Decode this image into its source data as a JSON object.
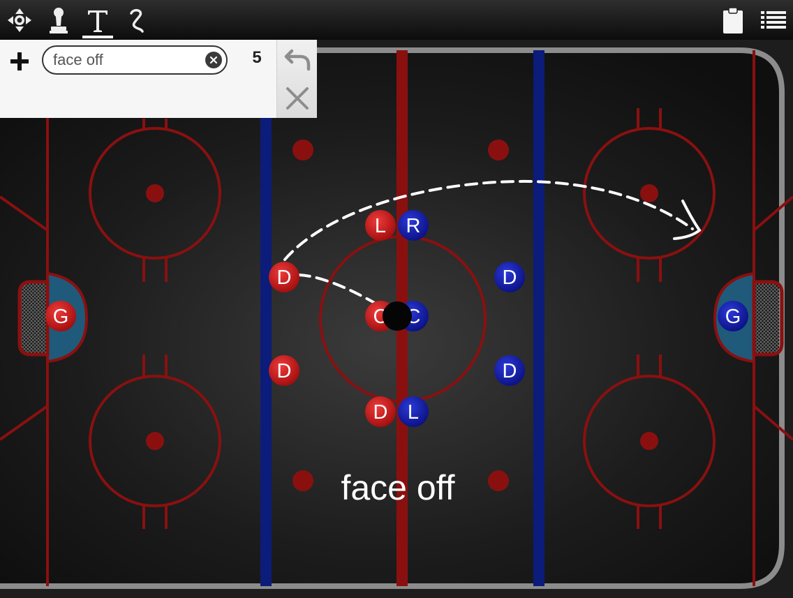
{
  "toolbar": {
    "tools": [
      {
        "name": "move-icon",
        "active": false
      },
      {
        "name": "player-piece-icon",
        "active": false
      },
      {
        "name": "text-tool-icon",
        "active": true
      },
      {
        "name": "draw-path-icon",
        "active": false
      }
    ],
    "right": [
      "clipboard-icon",
      "list-menu-icon"
    ]
  },
  "panel": {
    "search_value": "face off",
    "count": "5"
  },
  "colors": {
    "red_team": "#cc1111",
    "blue_team": "#0a1aa8",
    "line_red": "#8a1010",
    "line_blue": "#0c1c7a",
    "crease": "#1f5a7a"
  },
  "rink": {
    "caption": "face off",
    "players": [
      {
        "label": "L",
        "team": "red"
      },
      {
        "label": "R",
        "team": "blue"
      },
      {
        "label": "D",
        "team": "red"
      },
      {
        "label": "D",
        "team": "blue"
      },
      {
        "label": "C",
        "team": "red"
      },
      {
        "label": "C",
        "team": "blue"
      },
      {
        "label": "D",
        "team": "red"
      },
      {
        "label": "D",
        "team": "blue"
      },
      {
        "label": "D",
        "team": "red"
      },
      {
        "label": "L",
        "team": "blue"
      },
      {
        "label": "G",
        "team": "red"
      },
      {
        "label": "G",
        "team": "blue"
      }
    ]
  }
}
